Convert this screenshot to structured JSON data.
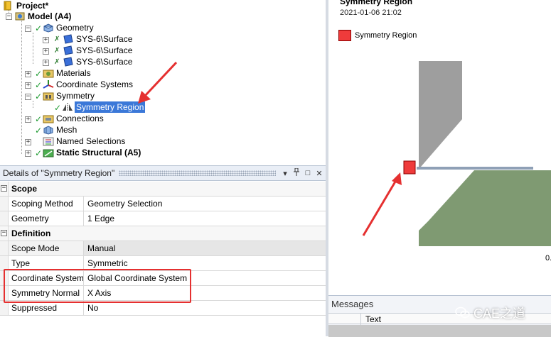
{
  "tree": {
    "project": "Project*",
    "model": "Model (A4)",
    "geometry": "Geometry",
    "surfaces": [
      "SYS-6\\Surface",
      "SYS-6\\Surface",
      "SYS-6\\Surface"
    ],
    "materials": "Materials",
    "coordinate_systems": "Coordinate Systems",
    "symmetry": "Symmetry",
    "symmetry_region": "Symmetry Region",
    "connections": "Connections",
    "mesh": "Mesh",
    "named_selections": "Named Selections",
    "static_structural": "Static Structural (A5)"
  },
  "details": {
    "title": "Details of \"Symmetry Region\"",
    "buttons": {
      "dropdown": "▾",
      "pin": "⊥",
      "maximize": "□",
      "close": "✕"
    },
    "sections": {
      "scope": "Scope",
      "definition": "Definition"
    },
    "rows": {
      "scoping_method": {
        "key": "Scoping Method",
        "value": "Geometry Selection"
      },
      "geometry": {
        "key": "Geometry",
        "value": "1 Edge"
      },
      "scope_mode": {
        "key": "Scope Mode",
        "value": "Manual"
      },
      "type": {
        "key": "Type",
        "value": "Symmetric"
      },
      "coordinate_system": {
        "key": "Coordinate System",
        "value": "Global Coordinate System"
      },
      "symmetry_normal": {
        "key": "Symmetry Normal",
        "value": "X Axis"
      },
      "suppressed": {
        "key": "Suppressed",
        "value": "No"
      }
    }
  },
  "viewport": {
    "title": "Symmetry Region",
    "date": "2021-01-06 21:02",
    "legend_label": "Symmetry Region",
    "legend_color": "#ef3b3b",
    "scale_text": "0.",
    "colors": {
      "upper_part": "#9e9e9e",
      "lower_part": "#7f9a72",
      "plate": "#8fa0b6"
    }
  },
  "messages": {
    "title": "Messages",
    "column_text": "Text"
  },
  "watermark": "CAE之道",
  "colors": {
    "highlight_red": "#e53030",
    "selection_blue": "#3b78d8"
  }
}
